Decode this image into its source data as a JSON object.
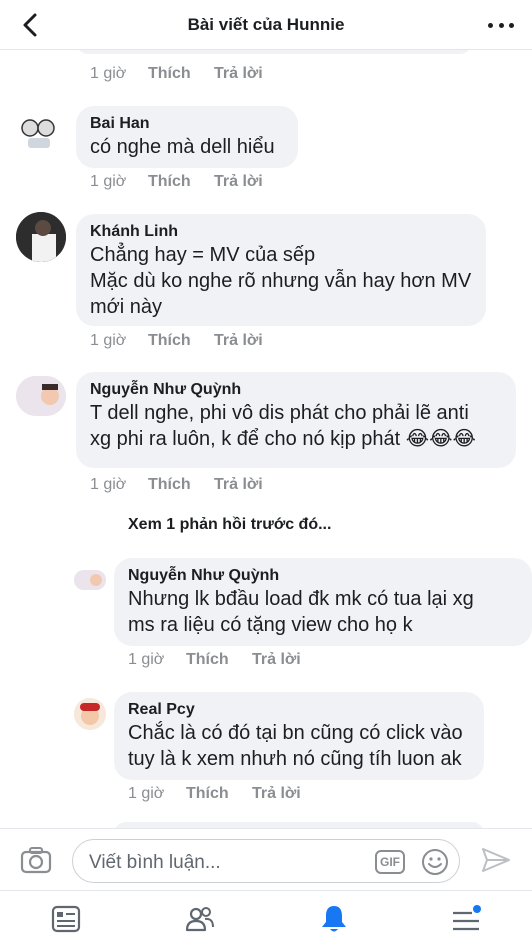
{
  "header": {
    "title": "Bài viết của Hunnie"
  },
  "actions": {
    "time": "1 giờ",
    "like": "Thích",
    "reply": "Trả lời"
  },
  "comments": [
    {
      "author": "Bai Han",
      "lines": [
        "có nghe mà dell hiểu"
      ]
    },
    {
      "author": "Khánh Linh",
      "lines": [
        "Chẳng hay = MV của sếp",
        "Mặc dù ko nghe rõ nhưng vẫn hay hơn MV",
        "mới này"
      ]
    },
    {
      "author": "Nguyễn Như Quỳnh",
      "lines": [
        "T dell nghe, phi vô dis phát cho phải lẽ anti",
        "xg phi ra luôn, k để cho nó kịp phát 😂😂😂"
      ]
    }
  ],
  "view_previous": "Xem 1 phản hồi trước đó...",
  "replies": [
    {
      "author": "Nguyễn Như Quỳnh",
      "lines": [
        "Nhưng lk bđầu load đk mk có tua lại xg",
        "ms ra liệu có tặng view cho họ k"
      ]
    },
    {
      "author": "Real Pcy",
      "lines": [
        "Chắc là có đó tại bn cũng có click vào",
        "tuy là k xem nhưh nó cũng tíh luon ak"
      ]
    }
  ],
  "composer": {
    "placeholder": "Viết bình luận...",
    "gif_label": "GIF"
  },
  "icons": {
    "back": "chevron-left-icon",
    "more": "more-dots-icon",
    "camera": "camera-icon",
    "emoji": "smiley-icon",
    "send": "send-icon",
    "news_feed": "news-feed-icon",
    "friends": "friends-icon",
    "notifications": "bell-icon",
    "menu": "menu-icon"
  },
  "colors": {
    "accent": "#1877f2",
    "bubble": "#f0f2f5",
    "meta": "#8a8d91"
  }
}
